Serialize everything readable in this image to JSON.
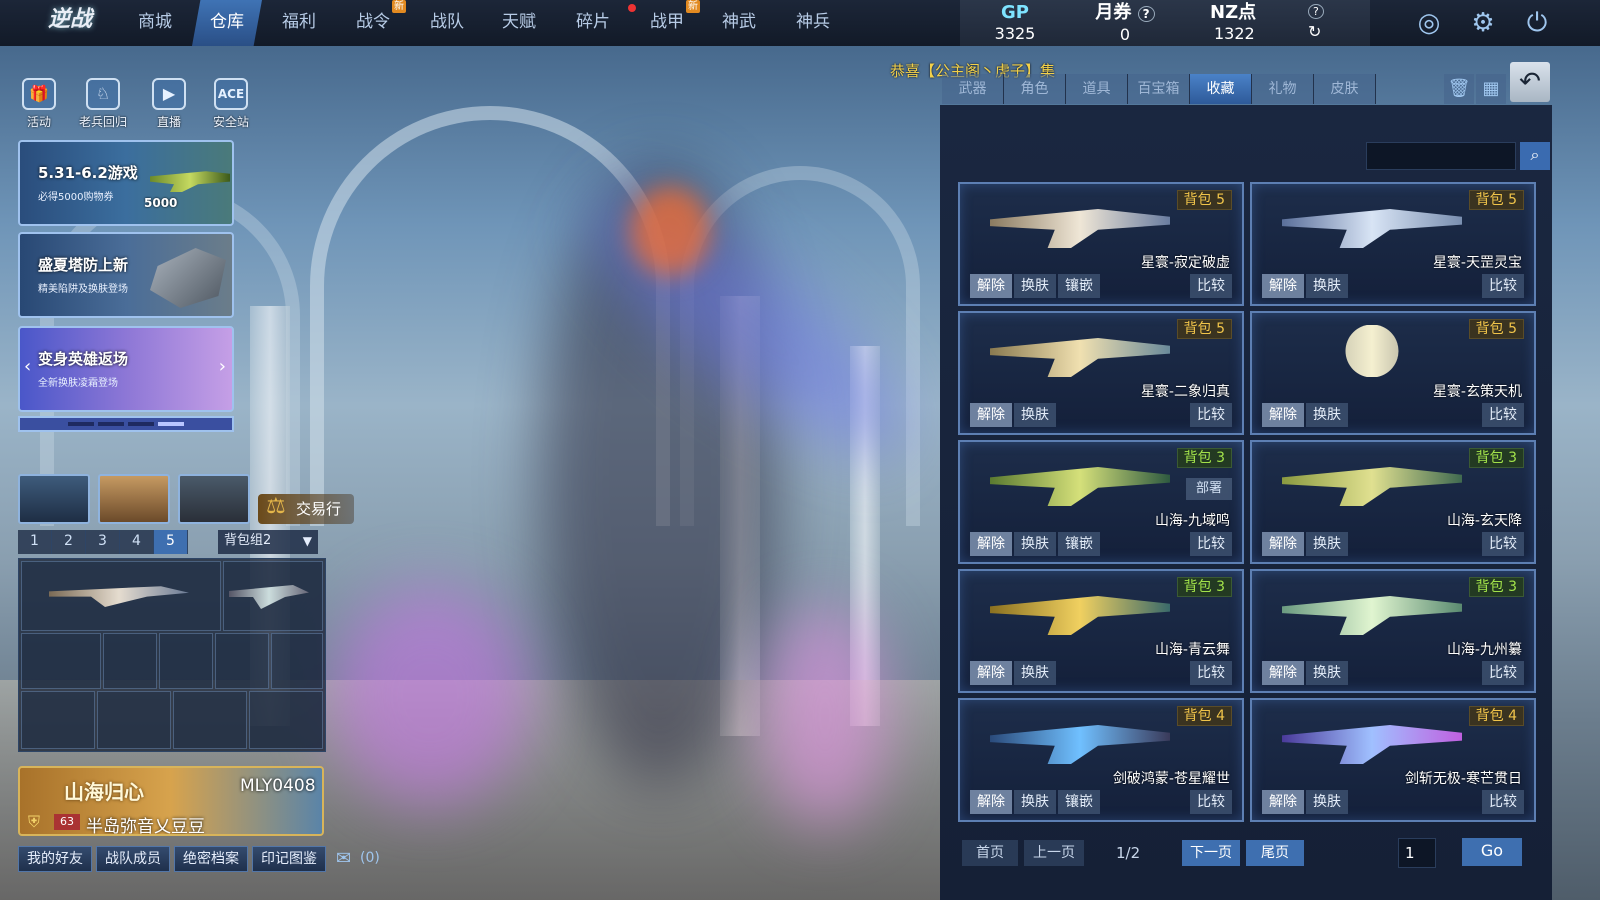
{
  "logo": "逆战",
  "nav": {
    "tabs": [
      {
        "label": "商城"
      },
      {
        "label": "仓库",
        "active": true
      },
      {
        "label": "福利"
      },
      {
        "label": "战令",
        "badge": "新"
      },
      {
        "label": "战队"
      },
      {
        "label": "天赋"
      },
      {
        "label": "碎片"
      },
      {
        "label": "战甲",
        "badge": "新"
      },
      {
        "label": "神武"
      },
      {
        "label": "神兵"
      }
    ]
  },
  "currency": {
    "gp_label": "GP",
    "gp_value": "3325",
    "month_label": "月券",
    "month_value": "0",
    "nz_label": "NZ点",
    "nz_value": "1322"
  },
  "announcement": "恭喜【公主阁丶虎子】集",
  "left_icons": [
    {
      "label": "活动",
      "icon": "gift-icon"
    },
    {
      "label": "老兵回归",
      "icon": "veteran-icon"
    },
    {
      "label": "直播",
      "icon": "tv-icon"
    },
    {
      "label": "安全站",
      "icon": "ace-icon"
    }
  ],
  "banners": [
    {
      "title": "5.31-6.2游戏",
      "subtitle": "必得5000购物券",
      "extra": "5000"
    },
    {
      "title": "盛夏塔防上新",
      "subtitle": "精美陷阱及换肤登场"
    },
    {
      "title": "变身英雄返场",
      "subtitle": "全新换肤凌霜登场"
    }
  ],
  "trade_label": "交易行",
  "bag_pages": [
    "1",
    "2",
    "3",
    "4",
    "5"
  ],
  "bag_group": "背包组2",
  "profile": {
    "title": "山海归心",
    "id": "MLY0408",
    "level": "63",
    "name": "半岛弥音乂豆豆"
  },
  "bottom_buttons": [
    "我的好友",
    "战队成员",
    "绝密档案",
    "印记图鉴"
  ],
  "mail_count": "(0)",
  "inventory_tabs": [
    {
      "label": "武器"
    },
    {
      "label": "角色"
    },
    {
      "label": "道具"
    },
    {
      "label": "百宝箱"
    },
    {
      "label": "收藏",
      "active": true
    },
    {
      "label": "礼物"
    },
    {
      "label": "皮肤"
    }
  ],
  "actions": {
    "unequip": "解除",
    "skin": "换肤",
    "inlay": "镶嵌",
    "compare": "比较",
    "deploy": "部署"
  },
  "items": [
    {
      "name": "星寰-寂定破虚",
      "bag": "背包 5",
      "inlay": true
    },
    {
      "name": "星寰-天罡灵宝",
      "bag": "背包 5",
      "inlay": false
    },
    {
      "name": "星寰-二象归真",
      "bag": "背包 5",
      "inlay": false
    },
    {
      "name": "星寰-玄策天机",
      "bag": "背包 5",
      "inlay": false
    },
    {
      "name": "山海-九域鸣",
      "bag": "背包 3",
      "inlay": true,
      "deploy": true
    },
    {
      "name": "山海-玄天降",
      "bag": "背包 3",
      "inlay": false
    },
    {
      "name": "山海-青云舞",
      "bag": "背包 3",
      "inlay": false
    },
    {
      "name": "山海-九州纂",
      "bag": "背包 3",
      "inlay": false
    },
    {
      "name": "剑破鸿蒙-苍星耀世",
      "bag": "背包 4",
      "inlay": true
    },
    {
      "name": "剑斩无极-寒芒贯日",
      "bag": "背包 4",
      "inlay": false
    }
  ],
  "pager": {
    "first": "首页",
    "prev": "上一页",
    "indicator": "1/2",
    "next": "下一页",
    "last": "尾页",
    "page_input": "1",
    "go": "Go"
  }
}
